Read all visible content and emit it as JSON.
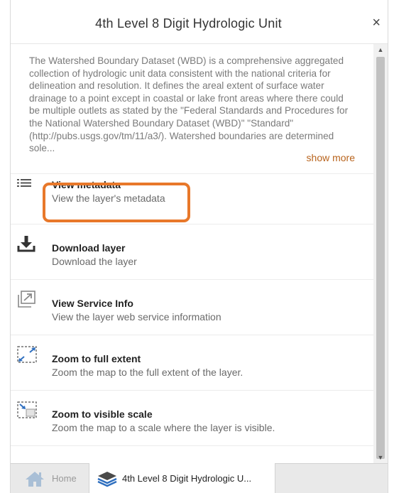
{
  "panel": {
    "title": "4th Level 8 Digit Hydrologic Unit",
    "close_symbol": "×"
  },
  "description": {
    "text": "The Watershed Boundary Dataset (WBD) is a comprehensive aggregated collection of hydrologic unit data consistent with the national criteria for delineation and resolution. It defines the areal extent of surface water drainage to a point except in coastal or lake front areas where there could be multiple outlets as stated by the \"Federal Standards and Procedures for the National Watershed Boundary Dataset (WBD)\" \"Standard\" (http://pubs.usgs.gov/tm/11/a3/). Watershed boundaries are determined sole...",
    "show_more": "show more",
    "link_color": "#b8631c"
  },
  "actions": [
    {
      "icon": "list-icon",
      "label": "View metadata",
      "sub": "View the layer's metadata"
    },
    {
      "icon": "download-icon",
      "label": "Download layer",
      "sub": "Download the layer"
    },
    {
      "icon": "external-window-icon",
      "label": "View Service Info",
      "sub": "View the layer web service information"
    },
    {
      "icon": "full-extent-icon",
      "label": "Zoom to full extent",
      "sub": "Zoom the map to the full extent of the layer."
    },
    {
      "icon": "zoom-scale-icon",
      "label": "Zoom to visible scale",
      "sub": "Zoom the map to a scale where the layer is visible."
    }
  ],
  "highlight_color": "#e8782a",
  "tabs": {
    "home_label": "Home",
    "layer_label": "4th Level 8 Digit Hydrologic U..."
  }
}
